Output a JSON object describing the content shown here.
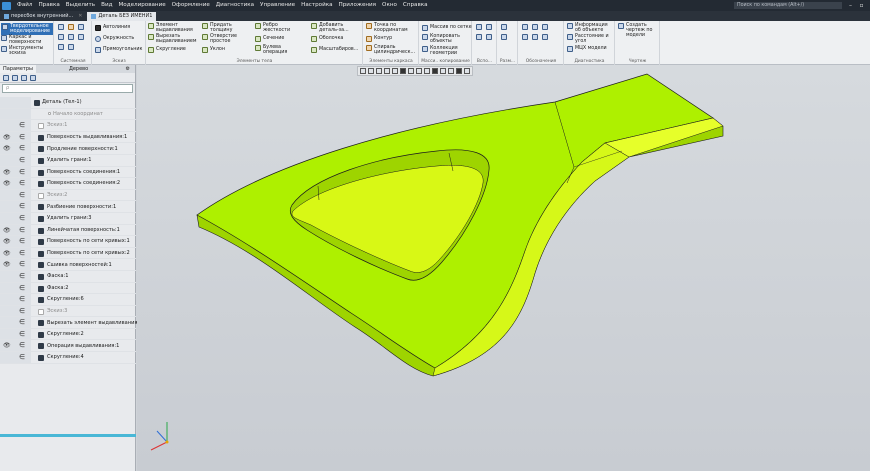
{
  "menu": [
    "Файл",
    "Правка",
    "Выделить",
    "Вид",
    "Моделирование",
    "Оформление",
    "Диагностика",
    "Управление",
    "Настройка",
    "Приложения",
    "Окно",
    "Справка"
  ],
  "search_placeholder": "Поиск по командам (Alt+/)",
  "tabs": [
    "пересбок внутренний...",
    "Деталь БЕЗ ИМЕНИ1"
  ],
  "ribbon": {
    "left": [
      "Твердотельное моделирование",
      "Каркас и поверхности",
      "Инструменты эскиза"
    ],
    "sys": "Системная",
    "eskiz": [
      "Автолиния",
      "Окружность",
      "Прямоугольник"
    ],
    "eskiz_name": "Эскиз",
    "elems": [
      "Элемент выдавливания",
      "Вырезать выдавливанием",
      "Скругление",
      "Придать толщину",
      "Отверстие простое",
      "Уклон",
      "Ребро жесткости",
      "Сечение",
      "Булева операция",
      "Добавить деталь-за...",
      "Оболочка",
      "Масштабиров..."
    ],
    "elems_name": "Элементы тела",
    "frame": [
      "Точка по координатам",
      "Контур",
      "Спираль цилиндрическ..."
    ],
    "frame_name": "Элементы каркаса",
    "mass": [
      "Массив по сетке",
      "Копировать объекты",
      "Коллекция геометрии"
    ],
    "mass_name": "Масси.. копирование",
    "vsp": "Вспо...",
    "razm": "Разм...",
    "oboz": "Обозначения",
    "diag": [
      "Информация об объекте",
      "Расстояние и угол",
      "МЦХ модели"
    ],
    "diag_name": "Диагностика",
    "draw": [
      "Создать чертеж по модели"
    ],
    "draw_name": "Чертеж"
  },
  "panel": {
    "title": "Параметры",
    "tab2": "Дерево",
    "filter": "ρ"
  },
  "tree": [
    {
      "label": "Деталь (Тел-1)",
      "eye": "",
      "dim": false
    },
    {
      "label": "Начало координат",
      "eye": "",
      "dim": true
    },
    {
      "label": "Эскиз:1",
      "eye": "",
      "dim": true
    },
    {
      "label": "Поверхность выдавливания:1",
      "eye": "👁",
      "dim": false
    },
    {
      "label": "Продление поверхности:1",
      "eye": "👁",
      "dim": false
    },
    {
      "label": "Удалить грани:1",
      "eye": "",
      "dim": false
    },
    {
      "label": "Поверхность соединения:1",
      "eye": "👁",
      "dim": false
    },
    {
      "label": "Поверхность соединения:2",
      "eye": "👁",
      "dim": false
    },
    {
      "label": "Эскиз:2",
      "eye": "",
      "dim": true
    },
    {
      "label": "Разбиение поверхности:1",
      "eye": "",
      "dim": false
    },
    {
      "label": "Удалить грани:3",
      "eye": "",
      "dim": false
    },
    {
      "label": "Линейчатая поверхность:1",
      "eye": "👁",
      "dim": false
    },
    {
      "label": "Поверхность по сети кривых:1",
      "eye": "👁",
      "dim": false
    },
    {
      "label": "Поверхность по сети кривых:2",
      "eye": "👁",
      "dim": false
    },
    {
      "label": "Сшивка поверхностей:1",
      "eye": "👁",
      "dim": false
    },
    {
      "label": "Фаска:1",
      "eye": "",
      "dim": false
    },
    {
      "label": "Фаска:2",
      "eye": "",
      "dim": false
    },
    {
      "label": "Скругление:6",
      "eye": "",
      "dim": false
    },
    {
      "label": "Эскиз:3",
      "eye": "",
      "dim": true
    },
    {
      "label": "Вырезать элемент выдавливания:1",
      "eye": "",
      "dim": false
    },
    {
      "label": "Скругление:2",
      "eye": "",
      "dim": false
    },
    {
      "label": "Операция выдавливания:1",
      "eye": "👁",
      "dim": false
    },
    {
      "label": "Скругление:4",
      "eye": "",
      "dim": false
    }
  ],
  "colors": {
    "body": "#aef000",
    "highlight": "#e6ff2a",
    "edge": "#1c1c1c"
  }
}
